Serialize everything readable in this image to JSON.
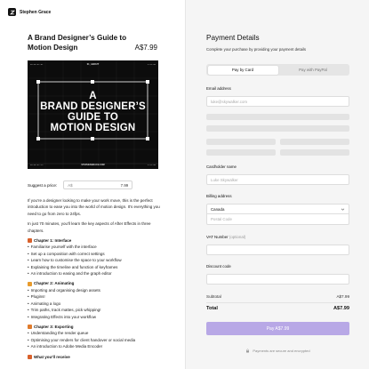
{
  "header": {
    "brand_name": "Stephen Grace"
  },
  "product": {
    "title": "A Brand Designer’s Guide to Motion Design",
    "price": "A$7.99",
    "cover": {
      "top_label": "01_ABOUT",
      "headline_1": "A",
      "headline_2": "BRAND DESIGNER’S",
      "headline_3": "GUIDE TO",
      "headline_4": "MOTION DESIGN",
      "bottom_label": "STEPHENGRACE.COM",
      "corner_tl": "00:00:01:01",
      "corner_tr": "4:02:00",
      "corner_bl": "00:00:01:24",
      "corner_br": "4:02:00"
    }
  },
  "suggest": {
    "label": "Suggest a price:",
    "currency": "A$",
    "value": "7.99"
  },
  "description": {
    "para1": "If you’re a designer looking to make your work move, this is the perfect introduction to ease you into the world of motion design. It’s everything you need to go from zero to 24fps.",
    "para2": "In just 70 minutes, you’ll learn the key aspects of After Effects in three chapters.",
    "chapters": [
      {
        "title": "Chapter 1: Interface",
        "icon_color": "#d9612b",
        "items": [
          "Familiarise yourself with the interface",
          "Set up a composition with correct settings",
          "Learn how to customise the space to your workflow",
          "Explaining the timeline and function of keyframes",
          "An introduction to easing and the graph editor"
        ]
      },
      {
        "title": "Chapter 2: Animating",
        "icon_color": "#e89b2d",
        "items": [
          "Importing and organising design assets",
          "Plugins!",
          "Animating a logo",
          "Trim paths, track mattes, pick whipping!",
          "Integrating Effects into your workflow"
        ]
      },
      {
        "title": "Chapter 3: Exporting",
        "icon_color": "#e07b2c",
        "items": [
          "Understanding the render queue",
          "Optimising your renders for client handover or social media",
          "An introduction to Adobe Media Encoder"
        ]
      },
      {
        "title": "What you’ll receive",
        "icon_color": "#d9612b",
        "items": []
      }
    ]
  },
  "payment": {
    "title": "Payment Details",
    "subtitle": "Complete your purchase by providing your payment details",
    "tabs": [
      {
        "label": "Pay by Card",
        "active": true
      },
      {
        "label": "Pay with PayPal",
        "active": false
      }
    ],
    "email_label": "Email address",
    "email_placeholder": "luke@skywalker.com",
    "cardholder_label": "Cardholder name",
    "cardholder_placeholder": "Luke Skywalker",
    "billing_label": "Billing address",
    "country_value": "Canada",
    "postal_placeholder": "Postal Code",
    "vat_label": "VAT Number",
    "vat_optional": "(optional)",
    "discount_label": "Discount code",
    "subtotal_label": "Subtotal",
    "subtotal_value": "A$7.99",
    "total_label": "Total",
    "total_value": "A$7.99",
    "pay_button": "Pay A$7.99",
    "secure_note": "Payments are secure and encrypted"
  },
  "colors": {
    "accent": "#b8a8e6",
    "panel_bg": "#f5f5f5"
  }
}
